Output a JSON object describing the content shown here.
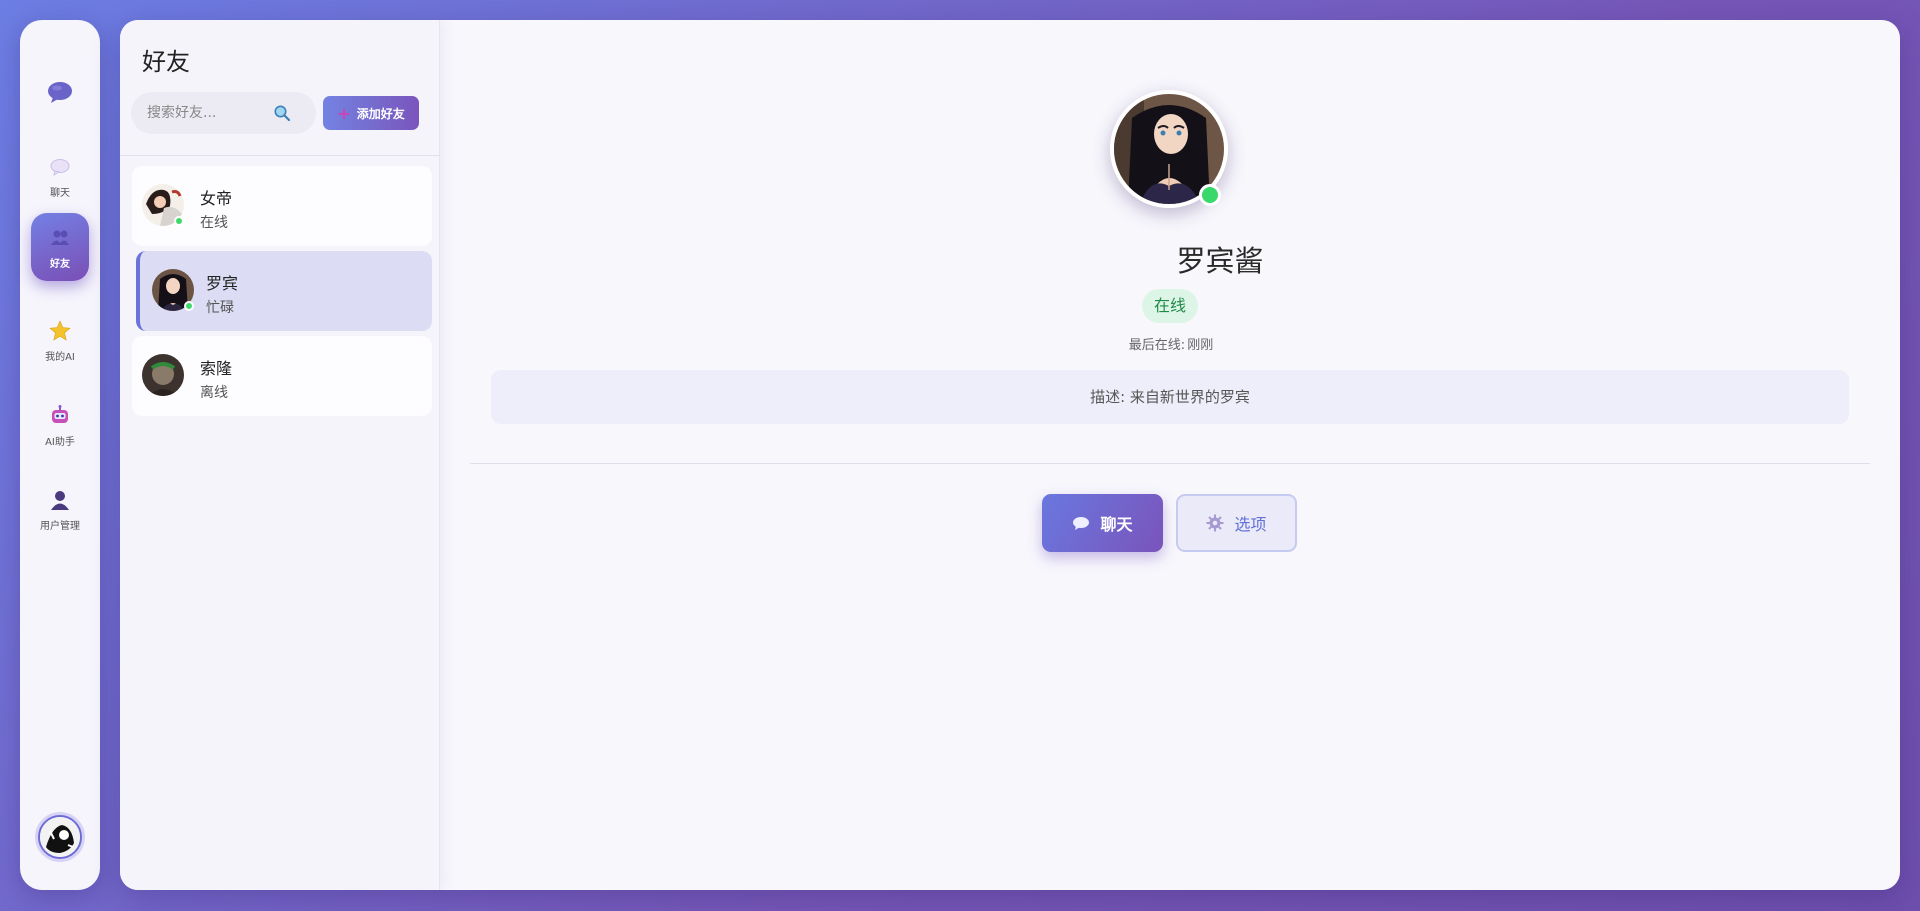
{
  "nav": {
    "items": [
      {
        "label": "聊天",
        "icon": "chat-bubble-icon"
      },
      {
        "label": "好友",
        "icon": "friends-icon"
      },
      {
        "label": "我的AI",
        "icon": "star-icon"
      },
      {
        "label": "AI助手",
        "icon": "robot-icon"
      },
      {
        "label": "用户管理",
        "icon": "user-icon"
      }
    ],
    "active_index": 1
  },
  "friends_panel": {
    "title": "好友",
    "search_placeholder": "搜索好友...",
    "add_button_label": "添加好友",
    "friends": [
      {
        "name": "女帝",
        "status": "在线",
        "online": true
      },
      {
        "name": "罗宾",
        "status": "忙碌",
        "online": true,
        "selected": true
      },
      {
        "name": "索隆",
        "status": "离线",
        "online": false
      }
    ]
  },
  "profile": {
    "name": "罗宾酱",
    "status": "在线",
    "last_online_label": "最后在线:",
    "last_online_value": "刚刚",
    "description": "描述: 来自新世界的罗宾",
    "chat_button": "聊天",
    "options_button": "选项"
  },
  "colors": {
    "accent": "#6b73db",
    "online": "#3fd96a",
    "gradient_start": "#6c7de3",
    "gradient_end": "#7657b8"
  }
}
